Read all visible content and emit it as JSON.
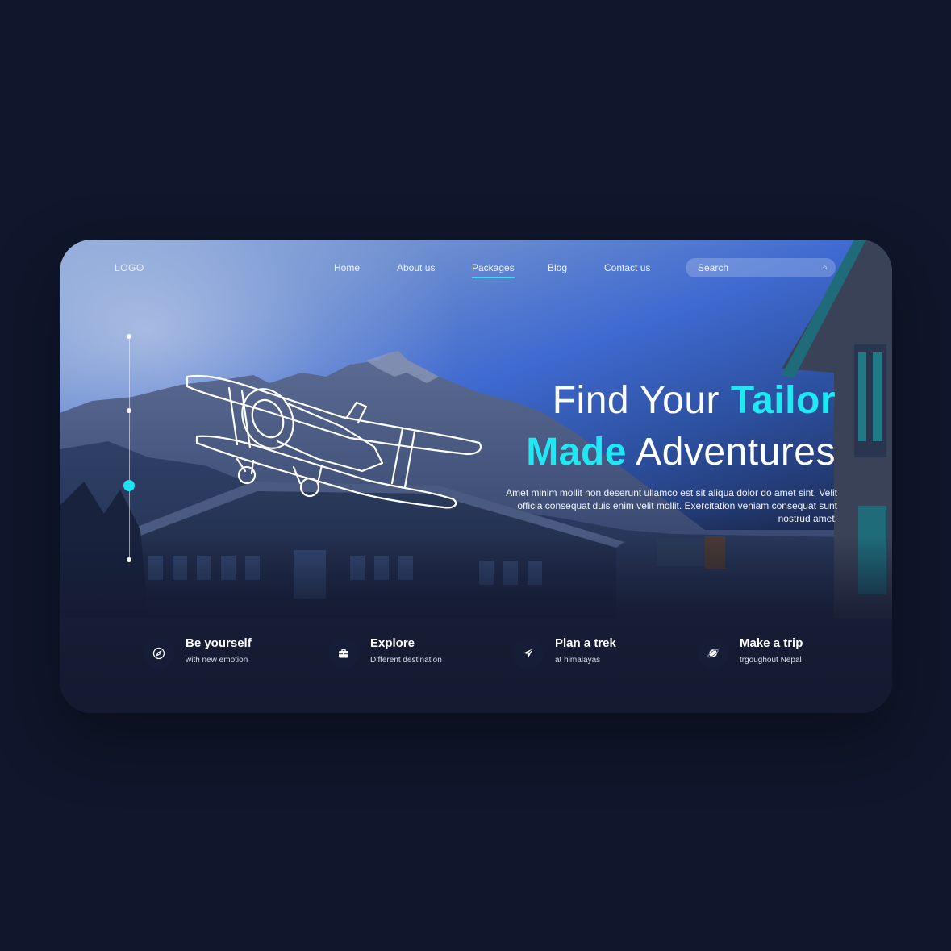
{
  "nav": {
    "logo": "LOGO",
    "items": [
      {
        "label": "Home"
      },
      {
        "label": "About us"
      },
      {
        "label": "Packages",
        "active": true
      },
      {
        "label": "Blog"
      },
      {
        "label": "Contact us"
      }
    ]
  },
  "search": {
    "placeholder": "Search",
    "icon": "search-icon"
  },
  "hero": {
    "line1_plain": "Find Your ",
    "line1_accent": "Tailor",
    "line2_accent": "Made",
    "line2_plain": " Adventures",
    "description": "Amet minim mollit non deserunt ullamco est sit aliqua dolor do amet sint. Velit officia consequat duis enim velit mollit. Exercitation veniam consequat sunt nostrud amet."
  },
  "slider": {
    "total": 4,
    "active": 3
  },
  "features": [
    {
      "icon": "compass-icon",
      "title": "Be yourself",
      "subtitle": "with new emotion"
    },
    {
      "icon": "briefcase-icon",
      "title": "Explore",
      "subtitle": "Different destination"
    },
    {
      "icon": "paper-plane-icon",
      "title": "Plan a trek",
      "subtitle": "at himalayas"
    },
    {
      "icon": "planet-icon",
      "title": "Make a trip",
      "subtitle": "trgoughout Nepal"
    }
  ],
  "colors": {
    "page_background": "#10162b",
    "accent": "#1fe8f2",
    "icon_circle": "#161d36"
  }
}
